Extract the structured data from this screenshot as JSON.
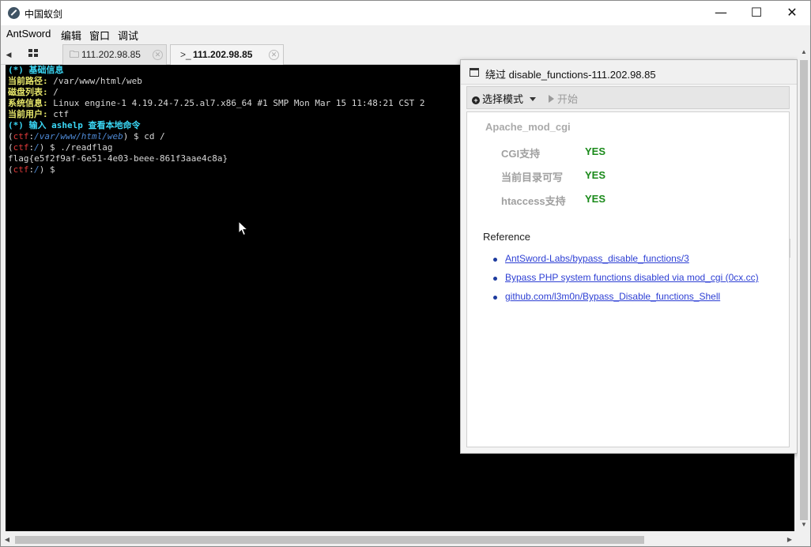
{
  "window": {
    "title": "中国蚁剑",
    "minimize_glyph": "—",
    "maximize_glyph": "☐",
    "close_glyph": "✕",
    "app_icon": "antsword-logo-icon"
  },
  "menubar": {
    "items": [
      "AntSword",
      "编辑",
      "窗口",
      "调试"
    ]
  },
  "tabs": {
    "left_arrow": "◀",
    "grid_icon": "grid-icon",
    "items": [
      {
        "icon": "🗀",
        "icon_name": "folder-icon",
        "label": "111.202.98.85",
        "close": "✕"
      },
      {
        "icon": ">_",
        "icon_name": "terminal-icon",
        "label": "111.202.98.85",
        "close": "✕"
      }
    ]
  },
  "terminal": {
    "lines": [
      [
        {
          "c": "t-cyan",
          "t": "(*) 基础信息"
        }
      ],
      [
        {
          "c": "t-yellow",
          "t": "当前路径: "
        },
        {
          "c": "t-white",
          "t": "/var/www/html/web"
        }
      ],
      [
        {
          "c": "t-yellow",
          "t": "磁盘列表: "
        },
        {
          "c": "t-white",
          "t": "/"
        }
      ],
      [
        {
          "c": "t-yellow",
          "t": "系统信息: "
        },
        {
          "c": "t-white",
          "t": "Linux engine-1 4.19.24-7.25.al7.x86_64 #1 SMP Mon Mar 15 11:48:21 CST 2"
        }
      ],
      [
        {
          "c": "t-yellow",
          "t": "当前用户: "
        },
        {
          "c": "t-white",
          "t": "ctf"
        }
      ],
      [
        {
          "c": "t-cyan",
          "t": "(*) 输入 ashelp 查看本地命令"
        }
      ],
      [
        {
          "c": "t-white",
          "t": "("
        },
        {
          "c": "t-red",
          "t": "ctf"
        },
        {
          "c": "t-white",
          "t": ":"
        },
        {
          "c": "t-blue",
          "t": "/var/www/html/web"
        },
        {
          "c": "t-white",
          "t": ") $ cd /"
        }
      ],
      [
        {
          "c": "t-white",
          "t": "("
        },
        {
          "c": "t-red",
          "t": "ctf"
        },
        {
          "c": "t-white",
          "t": ":"
        },
        {
          "c": "t-blue",
          "t": "/"
        },
        {
          "c": "t-white",
          "t": ") $ ./readflag"
        }
      ],
      [
        {
          "c": "t-white",
          "t": "flag{e5f2f9af-6e51-4e03-beee-861f3aae4c8a}"
        }
      ],
      [
        {
          "c": "t-white",
          "t": "("
        },
        {
          "c": "t-red",
          "t": "ctf"
        },
        {
          "c": "t-white",
          "t": ":"
        },
        {
          "c": "t-blue",
          "t": "/"
        },
        {
          "c": "t-white",
          "t": ") $"
        }
      ]
    ]
  },
  "panel": {
    "title": "绕过 disable_functions-111.202.98.85",
    "toolbar": {
      "select_mode": "选择模式",
      "start": "开始"
    },
    "module_title": "Apache_mod_cgi",
    "checks": [
      {
        "label": "CGI支持",
        "value": "YES"
      },
      {
        "label": "当前目录可写",
        "value": "YES"
      },
      {
        "label": "htaccess支持",
        "value": "YES"
      }
    ],
    "reference_title": "Reference",
    "references": [
      "AntSword-Labs/bypass_disable_functions/3",
      "Bypass PHP system functions disabled via mod_cgi (0cx.cc)",
      "github.com/l3m0n/Bypass_Disable_functions_Shell"
    ]
  },
  "scrollbars": {
    "up": "▲",
    "down": "▼",
    "left": "◀",
    "right": "▶"
  },
  "colors": {
    "terminal_bg": "#000000",
    "cyan": "#3ad7f5",
    "yellow": "#e6e66a",
    "prompt_red": "#e03a3a",
    "path_blue": "#4e8ad6",
    "yes_green": "#1a8a1a",
    "link_blue": "#2d3fd4"
  }
}
